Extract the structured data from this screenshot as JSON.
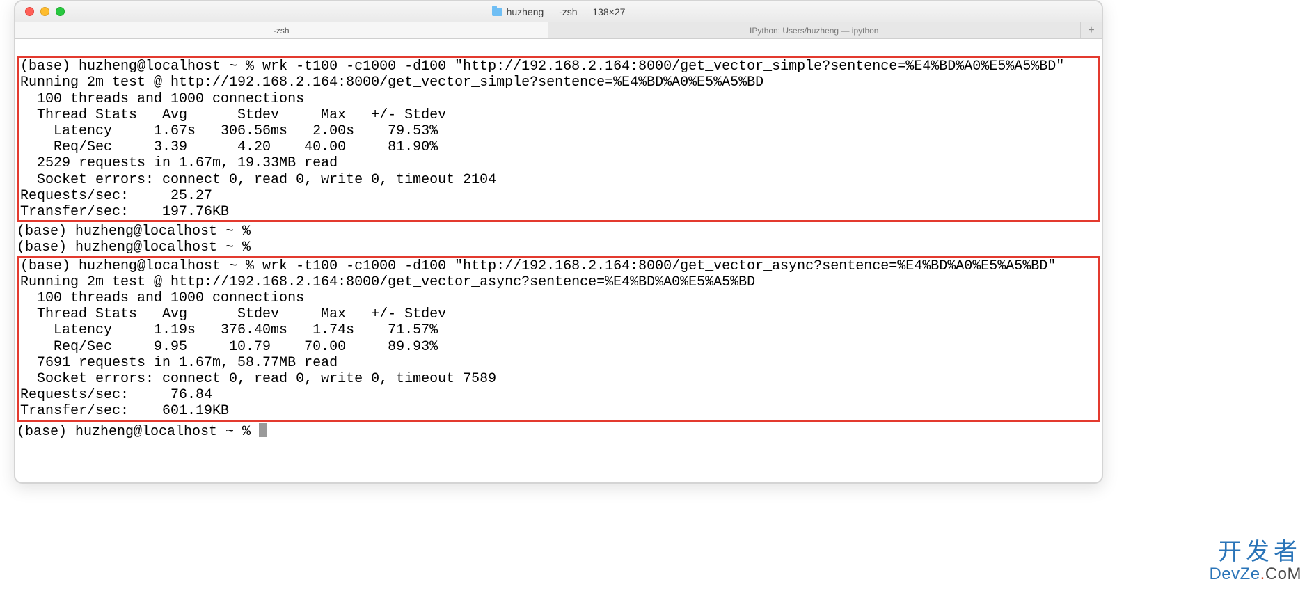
{
  "title_bar": {
    "title": "huzheng — -zsh — 138×27"
  },
  "tabs": {
    "left": "-zsh",
    "right": "IPython: Users/huzheng — ipython",
    "new": "+"
  },
  "term": {
    "box1": {
      "l1": "(base) huzheng@localhost ~ % wrk -t100 -c1000 -d100 \"http://192.168.2.164:8000/get_vector_simple?sentence=%E4%BD%A0%E5%A5%BD\"",
      "l2": "Running 2m test @ http://192.168.2.164:8000/get_vector_simple?sentence=%E4%BD%A0%E5%A5%BD",
      "l3": "  100 threads and 1000 connections",
      "l4": "  Thread Stats   Avg      Stdev     Max   +/- Stdev",
      "l5": "    Latency     1.67s   306.56ms   2.00s    79.53%",
      "l6": "    Req/Sec     3.39      4.20    40.00     81.90%",
      "l7": "  2529 requests in 1.67m, 19.33MB read",
      "l8": "  Socket errors: connect 0, read 0, write 0, timeout 2104",
      "l9": "Requests/sec:     25.27",
      "l10": "Transfer/sec:    197.76KB"
    },
    "mid": {
      "l1": "(base) huzheng@localhost ~ % ",
      "l2": "(base) huzheng@localhost ~ % "
    },
    "box2": {
      "l1": "(base) huzheng@localhost ~ % wrk -t100 -c1000 -d100 \"http://192.168.2.164:8000/get_vector_async?sentence=%E4%BD%A0%E5%A5%BD\"",
      "l2": "Running 2m test @ http://192.168.2.164:8000/get_vector_async?sentence=%E4%BD%A0%E5%A5%BD",
      "l3": "  100 threads and 1000 connections",
      "l4": "  Thread Stats   Avg      Stdev     Max   +/- Stdev",
      "l5": "    Latency     1.19s   376.40ms   1.74s    71.57%",
      "l6": "    Req/Sec     9.95     10.79    70.00     89.93%",
      "l7": "  7691 requests in 1.67m, 58.77MB read",
      "l8": "  Socket errors: connect 0, read 0, write 0, timeout 7589",
      "l9": "Requests/sec:     76.84",
      "l10": "Transfer/sec:    601.19KB"
    },
    "after": {
      "l1": "(base) huzheng@localhost ~ % "
    }
  },
  "watermark": {
    "line1": "开发者",
    "brand_a": "DevZe",
    "brand_dot": ".",
    "brand_b": "CoM"
  }
}
